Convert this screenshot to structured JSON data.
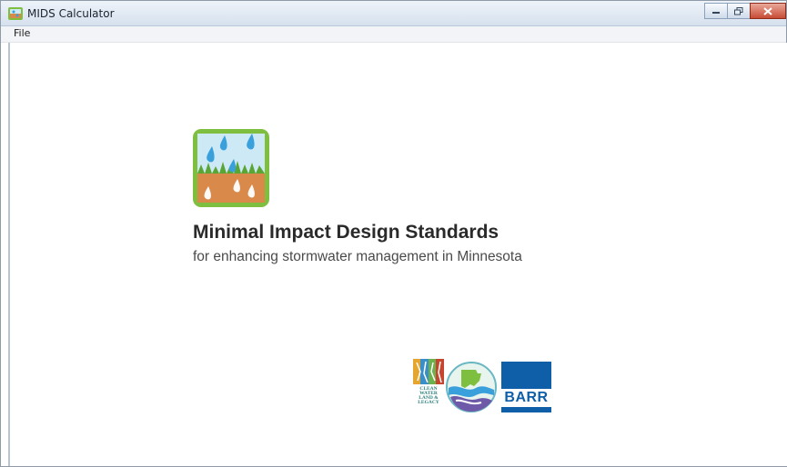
{
  "window": {
    "title": "MIDS Calculator"
  },
  "menu": {
    "file_label": "File"
  },
  "splash": {
    "heading": "Minimal Impact Design Standards",
    "subheading": "for enhancing stormwater management in Minnesota"
  },
  "logos": {
    "clean_water_text_1": "CLEAN",
    "clean_water_text_2": "WATER",
    "clean_water_text_3": "LAND &",
    "clean_water_text_4": "LEGACY",
    "barr": "BARR"
  },
  "colors": {
    "logo_green": "#7fbf3f",
    "logo_sky": "#cde9f5",
    "logo_soil": "#d98a4b",
    "barr_blue": "#0f5fa8"
  }
}
